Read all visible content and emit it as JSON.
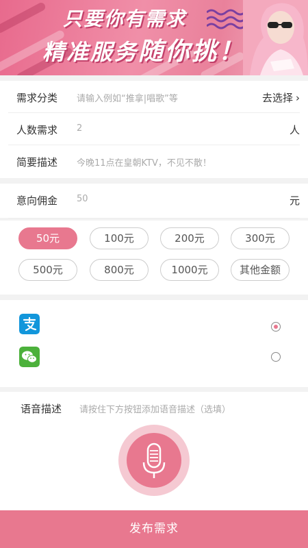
{
  "banner": {
    "line1": "只要你有需求",
    "line2a": "精准服务",
    "line2b": "随你挑！"
  },
  "form": {
    "category": {
      "label": "需求分类",
      "placeholder": "请输入例如“推拿|唱歌”等",
      "action": "去选择"
    },
    "people": {
      "label": "人数需求",
      "value": "2",
      "unit": "人"
    },
    "description": {
      "label": "简要描述",
      "placeholder": "今晚11点在皇朝KTV，不见不散！"
    },
    "commission": {
      "label": "意向佣金",
      "value": "50",
      "unit": "元"
    }
  },
  "amounts": {
    "selected": "50元",
    "options": [
      "50元",
      "100元",
      "200元",
      "300元",
      "500元",
      "800元",
      "1000元",
      "其他金额"
    ]
  },
  "payment": {
    "methods": [
      {
        "icon": "alipay-icon",
        "color": "#1296db",
        "selected": true
      },
      {
        "icon": "wechat-pay-icon",
        "color": "#4cb13b",
        "selected": false
      }
    ]
  },
  "voice": {
    "label": "语音描述",
    "placeholder": "请按住下方按钮添加语音描述（选填）",
    "icon": "microphone-icon"
  },
  "submit": {
    "label": "发布需求"
  },
  "colors": {
    "accent": "#e8788f",
    "accent_light": "#f5c9d2"
  }
}
